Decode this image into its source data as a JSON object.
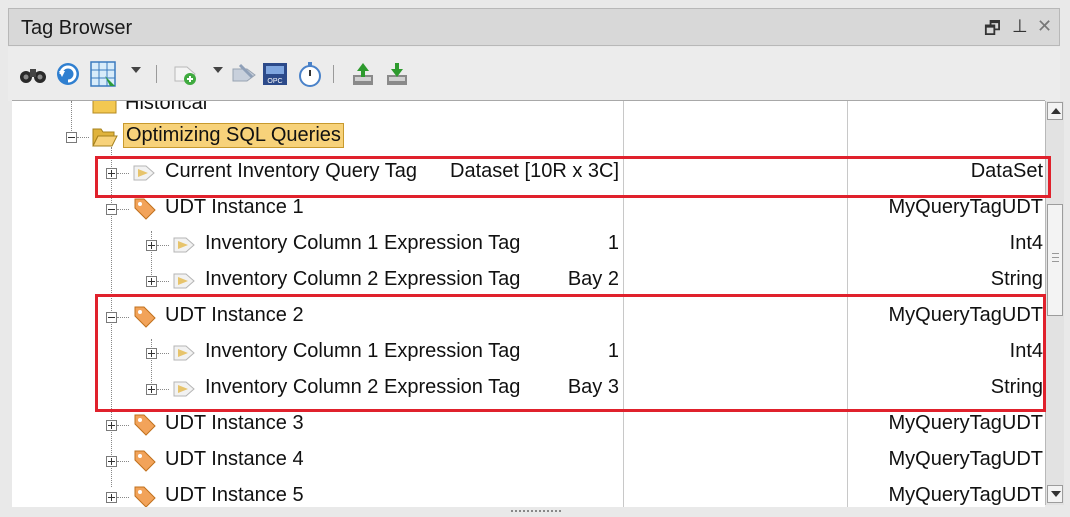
{
  "window": {
    "title": "Tag Browser"
  },
  "title_controls": {
    "restore": "🗗",
    "pin": "⊥",
    "close": "✕"
  },
  "toolbar": {
    "buttons": [
      "binoculars-icon",
      "refresh-icon",
      "grid-icon",
      "new-tag-icon",
      "edit-tag-icon",
      "opc-icon",
      "stopwatch-icon",
      "import-icon",
      "export-icon"
    ]
  },
  "tree": {
    "partial_top": "Historical",
    "folder": "Optimizing SQL Queries",
    "rows": [
      {
        "name": "Current Inventory Query Tag",
        "value": "Dataset [10R x 3C]",
        "type": "DataSet"
      },
      {
        "name": "UDT Instance 1",
        "value": "",
        "type": "MyQueryTagUDT"
      },
      {
        "name": "Inventory Column 1 Expression Tag",
        "value": "1",
        "type": "Int4"
      },
      {
        "name": "Inventory Column 2 Expression Tag",
        "value": "Bay 2",
        "type": "String"
      },
      {
        "name": "UDT Instance 2",
        "value": "",
        "type": "MyQueryTagUDT"
      },
      {
        "name": "Inventory Column 1 Expression Tag",
        "value": "1",
        "type": "Int4"
      },
      {
        "name": "Inventory Column 2 Expression Tag",
        "value": "Bay 3",
        "type": "String"
      },
      {
        "name": "UDT Instance 3",
        "value": "",
        "type": "MyQueryTagUDT"
      },
      {
        "name": "UDT Instance 4",
        "value": "",
        "type": "MyQueryTagUDT"
      },
      {
        "name": "UDT Instance 5",
        "value": "",
        "type": "MyQueryTagUDT"
      }
    ]
  },
  "colors": {
    "highlight": "#e0212c",
    "folder_selected": "#f7d27a"
  }
}
